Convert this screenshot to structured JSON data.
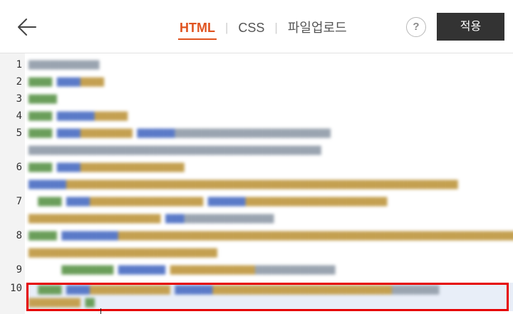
{
  "header": {
    "back_icon": "arrow-left-icon",
    "tabs": [
      {
        "label": "HTML",
        "active": true
      },
      {
        "label": "CSS",
        "active": false
      },
      {
        "label": "파일업로드",
        "active": false
      }
    ],
    "help_label": "?",
    "apply_label": "적용"
  },
  "editor": {
    "line_numbers": [
      "1",
      "2",
      "3",
      "4",
      "5",
      "6",
      "7",
      "8",
      "9",
      "10"
    ],
    "highlighted_line": "10",
    "colors": {
      "selection_border": "#e60000",
      "active_tab": "#e0531f",
      "apply_bg": "#333333"
    }
  }
}
